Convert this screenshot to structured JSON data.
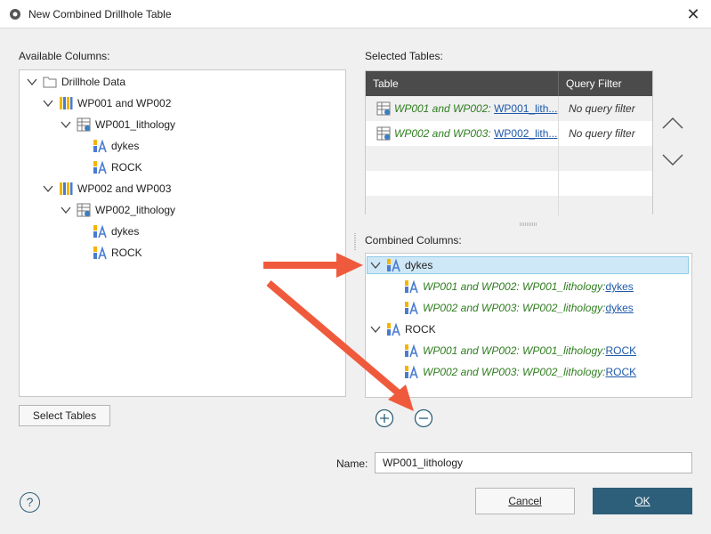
{
  "window": {
    "title": "New Combined Drillhole Table",
    "close_glyph": "✕"
  },
  "left_panel": {
    "label": "Available Columns:",
    "tree": {
      "root": "Drillhole Data",
      "groups": [
        {
          "name": "WP001 and WP002",
          "table": "WP001_lithology",
          "columns": [
            "dykes",
            "ROCK"
          ]
        },
        {
          "name": "WP002 and WP003",
          "table": "WP002_lithology",
          "columns": [
            "dykes",
            "ROCK"
          ]
        }
      ]
    },
    "select_tables_label": "Select Tables"
  },
  "right_panel": {
    "selected_tables_label": "Selected Tables:",
    "table_headers": [
      "Table",
      "Query Filter"
    ],
    "rows": [
      {
        "prefix": "WP001 and WP002: ",
        "link": "WP001_lith...",
        "filter": "No query filter"
      },
      {
        "prefix": "WP002 and WP003: ",
        "link": "WP002_lith...",
        "filter": "No query filter"
      }
    ],
    "combined_columns_label": "Combined Columns:",
    "combined": [
      {
        "name": "dykes",
        "children": [
          {
            "prefix": "WP001 and WP002: WP001_lithology: ",
            "link": "dykes"
          },
          {
            "prefix": "WP002 and WP003: WP002_lithology: ",
            "link": "dykes"
          }
        ]
      },
      {
        "name": "ROCK",
        "children": [
          {
            "prefix": "WP001 and WP002: WP001_lithology: ",
            "link": "ROCK"
          },
          {
            "prefix": "WP002 and WP003: WP002_lithology: ",
            "link": "ROCK"
          }
        ]
      }
    ]
  },
  "footer": {
    "name_label": "Name:",
    "name_value": "WP001_lithology",
    "cancel_label": "Cancel",
    "ok_label": "OK",
    "help_glyph": "?"
  },
  "colors": {
    "accent": "#2d5f7a",
    "annotation_arrow": "#f05a3c",
    "italic_text": "#2f7d1f",
    "link_text": "#1f5aa8"
  }
}
